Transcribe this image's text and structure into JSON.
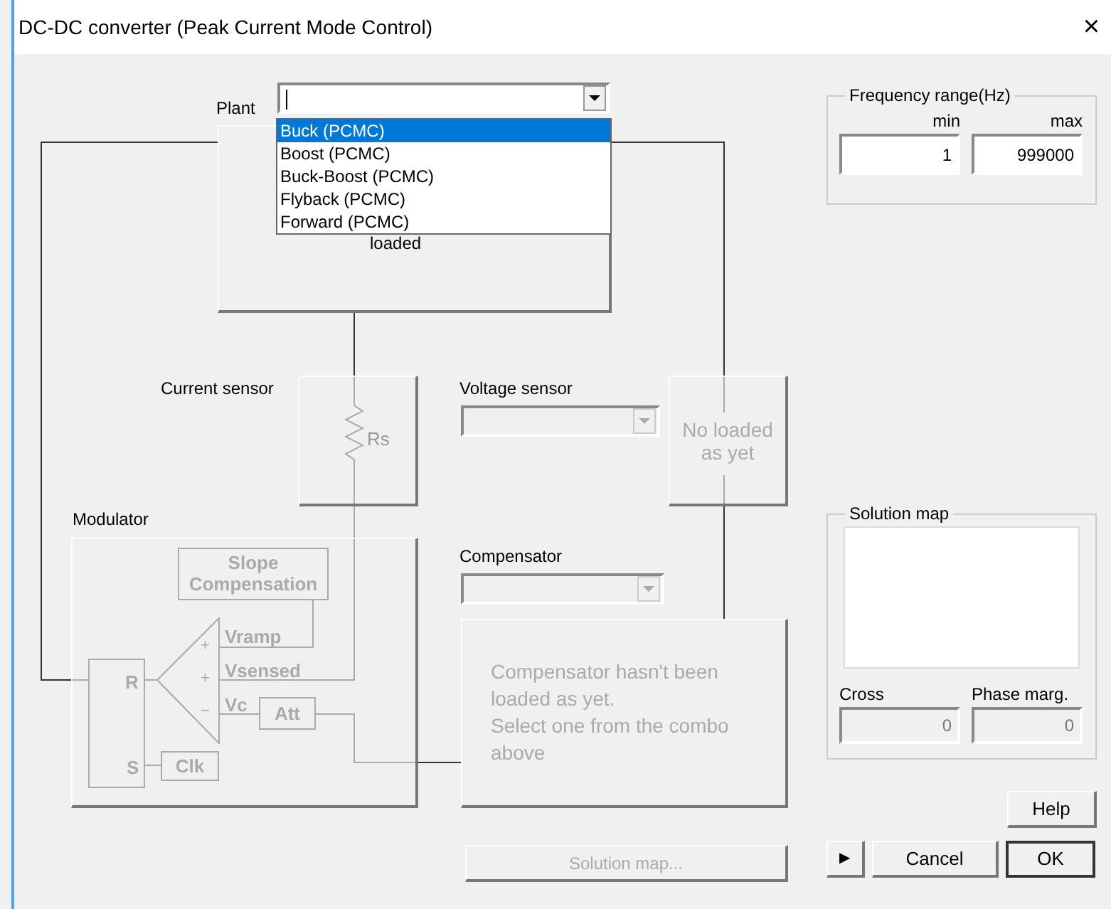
{
  "window": {
    "title": "DC-DC converter (Peak Current Mode Control)",
    "close": "×"
  },
  "plant": {
    "label": "Plant",
    "expanded": true,
    "message": "loaded",
    "options": [
      {
        "label": "Buck (PCMC)",
        "selected": true
      },
      {
        "label": "Boost (PCMC)",
        "selected": false
      },
      {
        "label": "Buck-Boost (PCMC)",
        "selected": false
      },
      {
        "label": "Flyback (PCMC)",
        "selected": false
      },
      {
        "label": "Forward (PCMC)",
        "selected": false
      }
    ]
  },
  "current_sensor": {
    "label": "Current sensor",
    "element": "Rs"
  },
  "voltage_sensor": {
    "label": "Voltage sensor",
    "disabled": true,
    "message": "No loaded as yet"
  },
  "modulator": {
    "label": "Modulator",
    "slope": "Slope Compensation",
    "vramp": "Vramp",
    "vsensed": "Vsensed",
    "vc": "Vc",
    "att": "Att",
    "r": "R",
    "s": "S",
    "clk": "Clk",
    "signs": [
      "+",
      "+",
      "−"
    ]
  },
  "compensator": {
    "label": "Compensator",
    "disabled": true,
    "message": "Compensator hasn't been loaded as yet.\nSelect one from the combo above"
  },
  "frequency_range": {
    "title": "Frequency range(Hz)",
    "min_label": "min",
    "max_label": "max",
    "min": "1",
    "max": "999000"
  },
  "solution_map": {
    "title": "Solution map",
    "cross_label": "Cross",
    "phase_label": "Phase marg.",
    "cross": "0",
    "phase": "0",
    "disabled": true
  },
  "buttons": {
    "solution_map": {
      "label": "Solution map...",
      "disabled": true
    },
    "help": "Help",
    "arrow": "▶",
    "cancel": "Cancel",
    "ok": "OK"
  }
}
